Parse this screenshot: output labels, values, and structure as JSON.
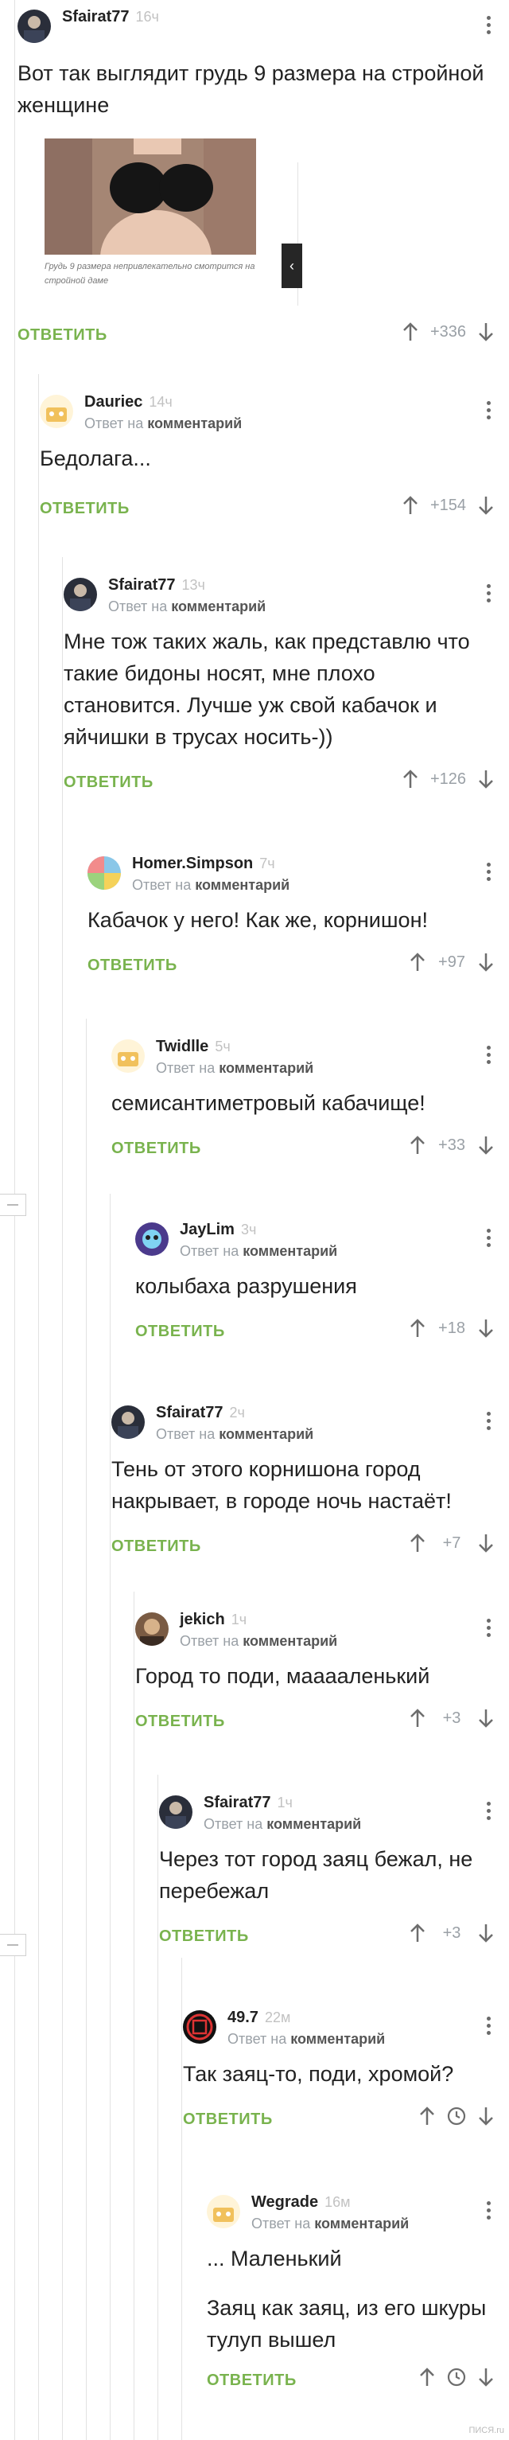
{
  "comments": [
    {
      "author": "Sfairat77",
      "time": "16ч",
      "reply_to_label": "",
      "reply_to_target": "",
      "body": [
        "Вот так выглядит грудь 9 размера на стройной женщине"
      ],
      "image_caption": "Грудь 9 размера непривлекательно смотрится на стройной даме",
      "reply_label": "ОТВЕТИТЬ",
      "votes": "+336"
    },
    {
      "author": "Dauriec",
      "time": "14ч",
      "reply_to_label": "Ответ на",
      "reply_to_target": "комментарий",
      "body": [
        "Бедолага..."
      ],
      "reply_label": "ОТВЕТИТЬ",
      "votes": "+154"
    },
    {
      "author": "Sfairat77",
      "time": "13ч",
      "reply_to_label": "Ответ на",
      "reply_to_target": "комментарий",
      "body": [
        "Мне тож таких жаль, как представлю что такие бидоны носят, мне плохо становится. Лучше уж свой кабачок и яйчишки в трусах носить-))"
      ],
      "reply_label": "ОТВЕТИТЬ",
      "votes": "+126"
    },
    {
      "author": "Homer.Simpson",
      "time": "7ч",
      "reply_to_label": "Ответ на",
      "reply_to_target": "комментарий",
      "body": [
        "Кабачок у него! Как же, корнишон!"
      ],
      "reply_label": "ОТВЕТИТЬ",
      "votes": "+97"
    },
    {
      "author": "Twidlle",
      "time": "5ч",
      "reply_to_label": "Ответ на",
      "reply_to_target": "комментарий",
      "body": [
        "семисантиметровый кабачище!"
      ],
      "reply_label": "ОТВЕТИТЬ",
      "votes": "+33"
    },
    {
      "author": "JayLim",
      "time": "3ч",
      "reply_to_label": "Ответ на",
      "reply_to_target": "комментарий",
      "body": [
        "колыбаха разрушения"
      ],
      "reply_label": "ОТВЕТИТЬ",
      "votes": "+18"
    },
    {
      "author": "Sfairat77",
      "time": "2ч",
      "reply_to_label": "Ответ на",
      "reply_to_target": "комментарий",
      "body": [
        "Тень от этого корнишона город накрывает, в городе ночь настаёт!"
      ],
      "reply_label": "ОТВЕТИТЬ",
      "votes": "+7"
    },
    {
      "author": "jekich",
      "time": "1ч",
      "reply_to_label": "Ответ на",
      "reply_to_target": "комментарий",
      "body": [
        "Город то поди, мааааленький"
      ],
      "reply_label": "ОТВЕТИТЬ",
      "votes": "+3"
    },
    {
      "author": "Sfairat77",
      "time": "1ч",
      "reply_to_label": "Ответ на",
      "reply_to_target": "комментарий",
      "body": [
        "Через тот город заяц бежал, не перебежал"
      ],
      "reply_label": "ОТВЕТИТЬ",
      "votes": "+3"
    },
    {
      "author": "49.7",
      "time": "22м",
      "reply_to_label": "Ответ на",
      "reply_to_target": "комментарий",
      "body": [
        "Так заяц-то, поди, хромой?"
      ],
      "reply_label": "ОТВЕТИТЬ",
      "votes": ""
    },
    {
      "author": "Wegrade",
      "time": "16м",
      "reply_to_label": "Ответ на",
      "reply_to_target": "комментарий",
      "body": [
        "... Маленький",
        "Заяц как заяц, из его шкуры тулуп вышел"
      ],
      "reply_label": "ОТВЕТИТЬ",
      "votes": ""
    }
  ],
  "icons": {
    "upvote": "arrow-up-icon",
    "downvote": "arrow-down-icon",
    "pending": "clock-icon",
    "more": "more-vertical-icon",
    "collapse": "collapse-minus-icon",
    "next_image": "chevron-left-icon"
  },
  "image_nav_label": "‹",
  "watermark": "ПИСЯ.ru",
  "colors": {
    "accent": "#79b34e",
    "muted": "#9aa0a6",
    "text": "#222222"
  }
}
